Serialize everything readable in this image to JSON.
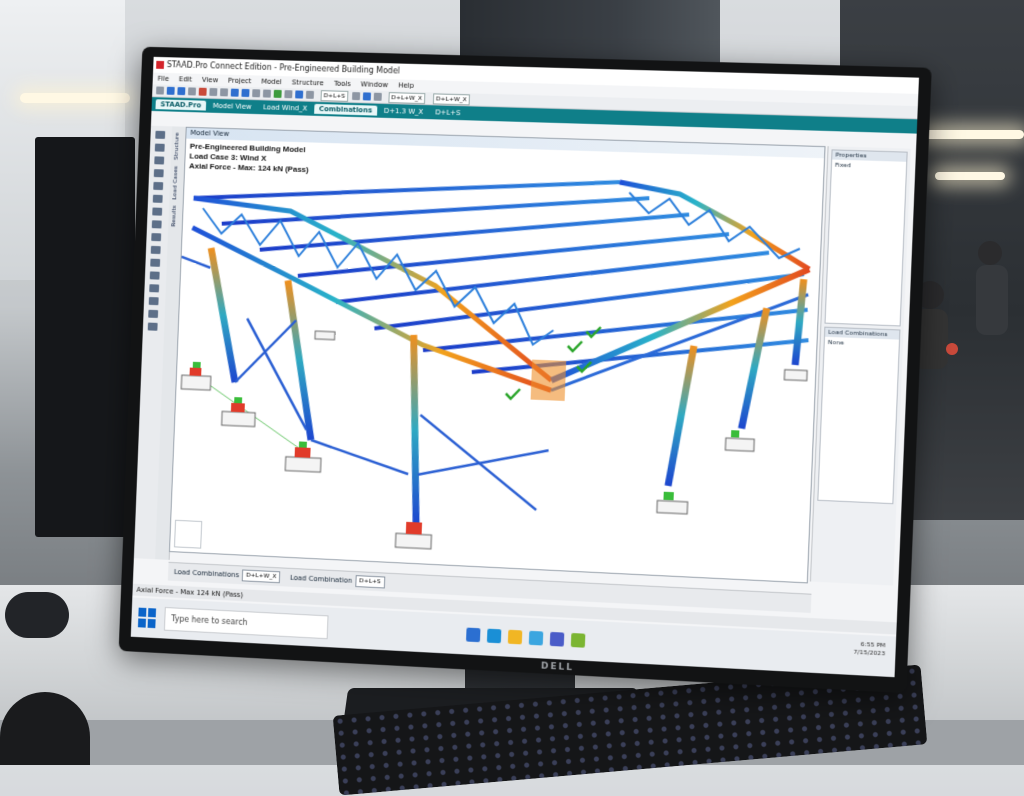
{
  "app": {
    "title": "STAAD.Pro Connect Edition - Pre-Engineered Building Model",
    "menu": [
      "File",
      "Edit",
      "View",
      "Project",
      "Model",
      "Structure",
      "Tools",
      "Window",
      "Help"
    ],
    "toolbar_combos": [
      "D+L+S",
      "D+L+W_X",
      "D+L+W_X"
    ]
  },
  "tabs": [
    "STAAD.Pro",
    "Model View",
    "Load Wind_X",
    "Combinations",
    "D+1.3 W_X",
    "D+L+S"
  ],
  "page_control_tabs": [
    "Structure",
    "Load Cases",
    "Results"
  ],
  "view": {
    "title": "Model View",
    "info_lines": [
      "Pre-Engineered Building Model",
      "Load Case 3: Wind X",
      "Axial Force - Max: 124 kN (Pass)"
    ]
  },
  "right_panel": {
    "properties_title": "Properties",
    "properties_item": "Fixed",
    "load_combinations_title": "Load Combinations",
    "load_combinations_item": "None"
  },
  "bottom_strip": {
    "label1": "Load Combinations",
    "combo1": "D+L+W_X",
    "label2": "Load Combination",
    "combo2": "D+L+S"
  },
  "status": "Axial Force - Max 124 kN (Pass)",
  "taskbar": {
    "search_placeholder": "Type here to search",
    "tray_line1": "6:55 PM",
    "tray_line2": "7/15/2023"
  },
  "monitor_brand": "DELL"
}
